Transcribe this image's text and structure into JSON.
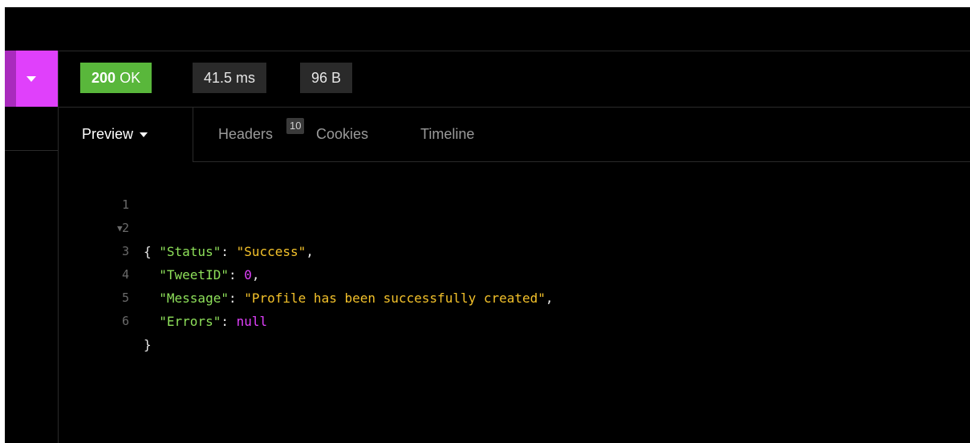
{
  "response": {
    "status_code": "200",
    "status_text": "OK",
    "time": "41.5 ms",
    "size": "96 B"
  },
  "tabs": {
    "preview": "Preview",
    "headers": "Headers",
    "headers_count": "10",
    "cookies": "Cookies",
    "timeline": "Timeline"
  },
  "code": {
    "line_numbers": [
      "1",
      "2",
      "3",
      "4",
      "5",
      "6"
    ],
    "open_brace": "{",
    "close_brace": "}",
    "entries": [
      {
        "key": "\"Status\"",
        "value": "\"Success\"",
        "type": "string",
        "comma": ","
      },
      {
        "key": "\"TweetID\"",
        "value": "0",
        "type": "number",
        "comma": ","
      },
      {
        "key": "\"Message\"",
        "value": "\"Profile has been successfully created\"",
        "type": "string",
        "comma": ","
      },
      {
        "key": "\"Errors\"",
        "value": "null",
        "type": "null",
        "comma": ""
      }
    ]
  },
  "colors": {
    "accent": "#e040fb",
    "status_ok": "#59b73b",
    "json_key": "#8ee05a",
    "json_string": "#f3c12a",
    "json_number": "#e040fb"
  },
  "icons": {
    "toggle": "caret-down-icon",
    "fold": "fold-triangle-icon"
  }
}
